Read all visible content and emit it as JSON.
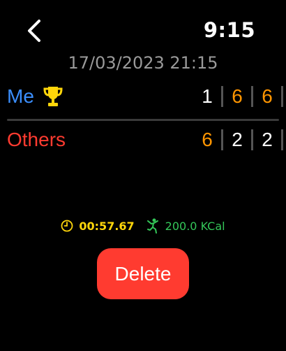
{
  "header": {
    "time": "9:15"
  },
  "match": {
    "date": "17/03/2023 21:15"
  },
  "players": {
    "me": {
      "name": "Me",
      "scores": [
        "1",
        "6",
        "6"
      ]
    },
    "others": {
      "name": "Others",
      "scores": [
        "6",
        "2",
        "2"
      ]
    }
  },
  "stats": {
    "duration": "00:57.67",
    "calories": "200.0 KCal"
  },
  "actions": {
    "delete_label": "Delete"
  },
  "colors": {
    "me": "#3b8fff",
    "others": "#ff3b30",
    "won_set": "#ff9500",
    "duration": "#ffd60a",
    "calories": "#34c759",
    "delete_button": "#ff3b30"
  },
  "icons": {
    "back": "chevron-left-icon",
    "winner": "trophy-icon",
    "duration": "clock-icon",
    "calories": "activity-figure-icon"
  }
}
